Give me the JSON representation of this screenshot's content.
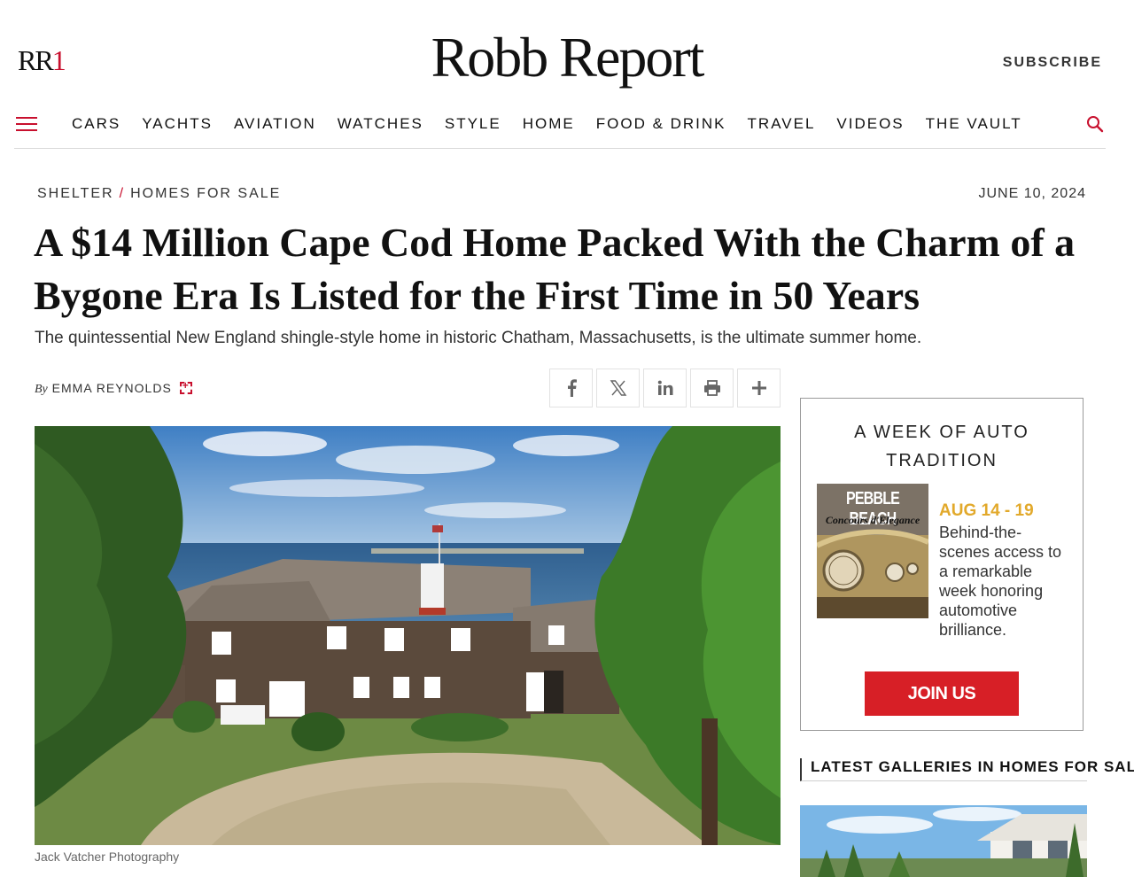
{
  "header": {
    "logo_rr": "RR",
    "logo_one": "1",
    "brand": "Robb Report",
    "subscribe": "SUBSCRIBE"
  },
  "nav": {
    "items": [
      "CARS",
      "YACHTS",
      "AVIATION",
      "WATCHES",
      "STYLE",
      "HOME",
      "FOOD & DRINK",
      "TRAVEL",
      "VIDEOS",
      "THE VAULT"
    ]
  },
  "article": {
    "crumb_1": "SHELTER",
    "crumb_sep": "/",
    "crumb_2": "HOMES FOR SALE",
    "date": "JUNE 10, 2024",
    "headline": "A $14 Million Cape Cod Home Packed With the Charm of a Bygone Era Is Listed for the First Time in 50 Years",
    "dek": "The quintessential New England shingle-style home in historic Chatham, Massachusetts, is the ultimate summer home.",
    "by": "By",
    "author": "EMMA REYNOLDS",
    "photo_credit": "Jack Vatcher Photography"
  },
  "share": {
    "icons": [
      "facebook-icon",
      "x-icon",
      "linkedin-icon",
      "print-icon",
      "plus-icon"
    ]
  },
  "ad": {
    "title": "A WEEK OF AUTO TRADITION",
    "img_title": "PEBBLE BEACH",
    "img_subtitle": "Concours d'Elegance",
    "dates": "AUG 14 - 19",
    "text": "Behind-the-scenes access to a remarkable week honoring automotive brilliance.",
    "button": "JOIN US"
  },
  "sidebar": {
    "galleries_heading": "LATEST GALLERIES IN HOMES FOR SALE"
  },
  "colors": {
    "accent": "#c8102e",
    "ad_button": "#d71f26",
    "ad_dates": "#e2a92b"
  }
}
